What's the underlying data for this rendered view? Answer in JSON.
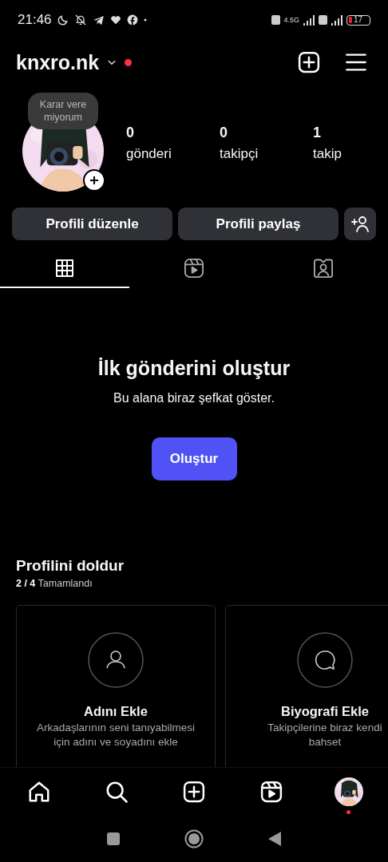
{
  "status_bar": {
    "time": "21:46",
    "network": "4.5G",
    "battery": "17"
  },
  "header": {
    "username": "knxro.nk",
    "has_notification": true
  },
  "profile": {
    "note": "Karar vere miyorum",
    "stats": [
      {
        "value": "0",
        "label": "gönderi"
      },
      {
        "value": "0",
        "label": "takipçi"
      },
      {
        "value": "1",
        "label": "takip"
      }
    ]
  },
  "actions": [
    "Profili düzenle",
    "Profili paylaş"
  ],
  "tabs": [
    {
      "kind": "grid",
      "selected": true
    },
    {
      "kind": "reels",
      "selected": false
    },
    {
      "kind": "tagged",
      "selected": false
    }
  ],
  "empty_state": {
    "title": "İlk gönderini oluştur",
    "subtitle": "Bu alana biraz şefkat göster.",
    "button": "Oluştur"
  },
  "complete_profile": {
    "title": "Profilini doldur",
    "progress": "**2 / 4** Tamamlandı",
    "cards": [
      {
        "kind": "person",
        "title": "Adını Ekle",
        "lines": [
          "Arkadaşlarının seni tanıyabilmesi",
          "için adını ve soyadını ekle"
        ]
      },
      {
        "kind": "bubble",
        "title": "Biyografi Ekle",
        "lines": [
          "Takipçilerine biraz kendi",
          "bahset"
        ]
      }
    ]
  },
  "bottom_nav": [
    {
      "kind": "home"
    },
    {
      "kind": "search"
    },
    {
      "kind": "create"
    },
    {
      "kind": "reels"
    },
    {
      "kind": "profile",
      "has_notification": true
    }
  ]
}
